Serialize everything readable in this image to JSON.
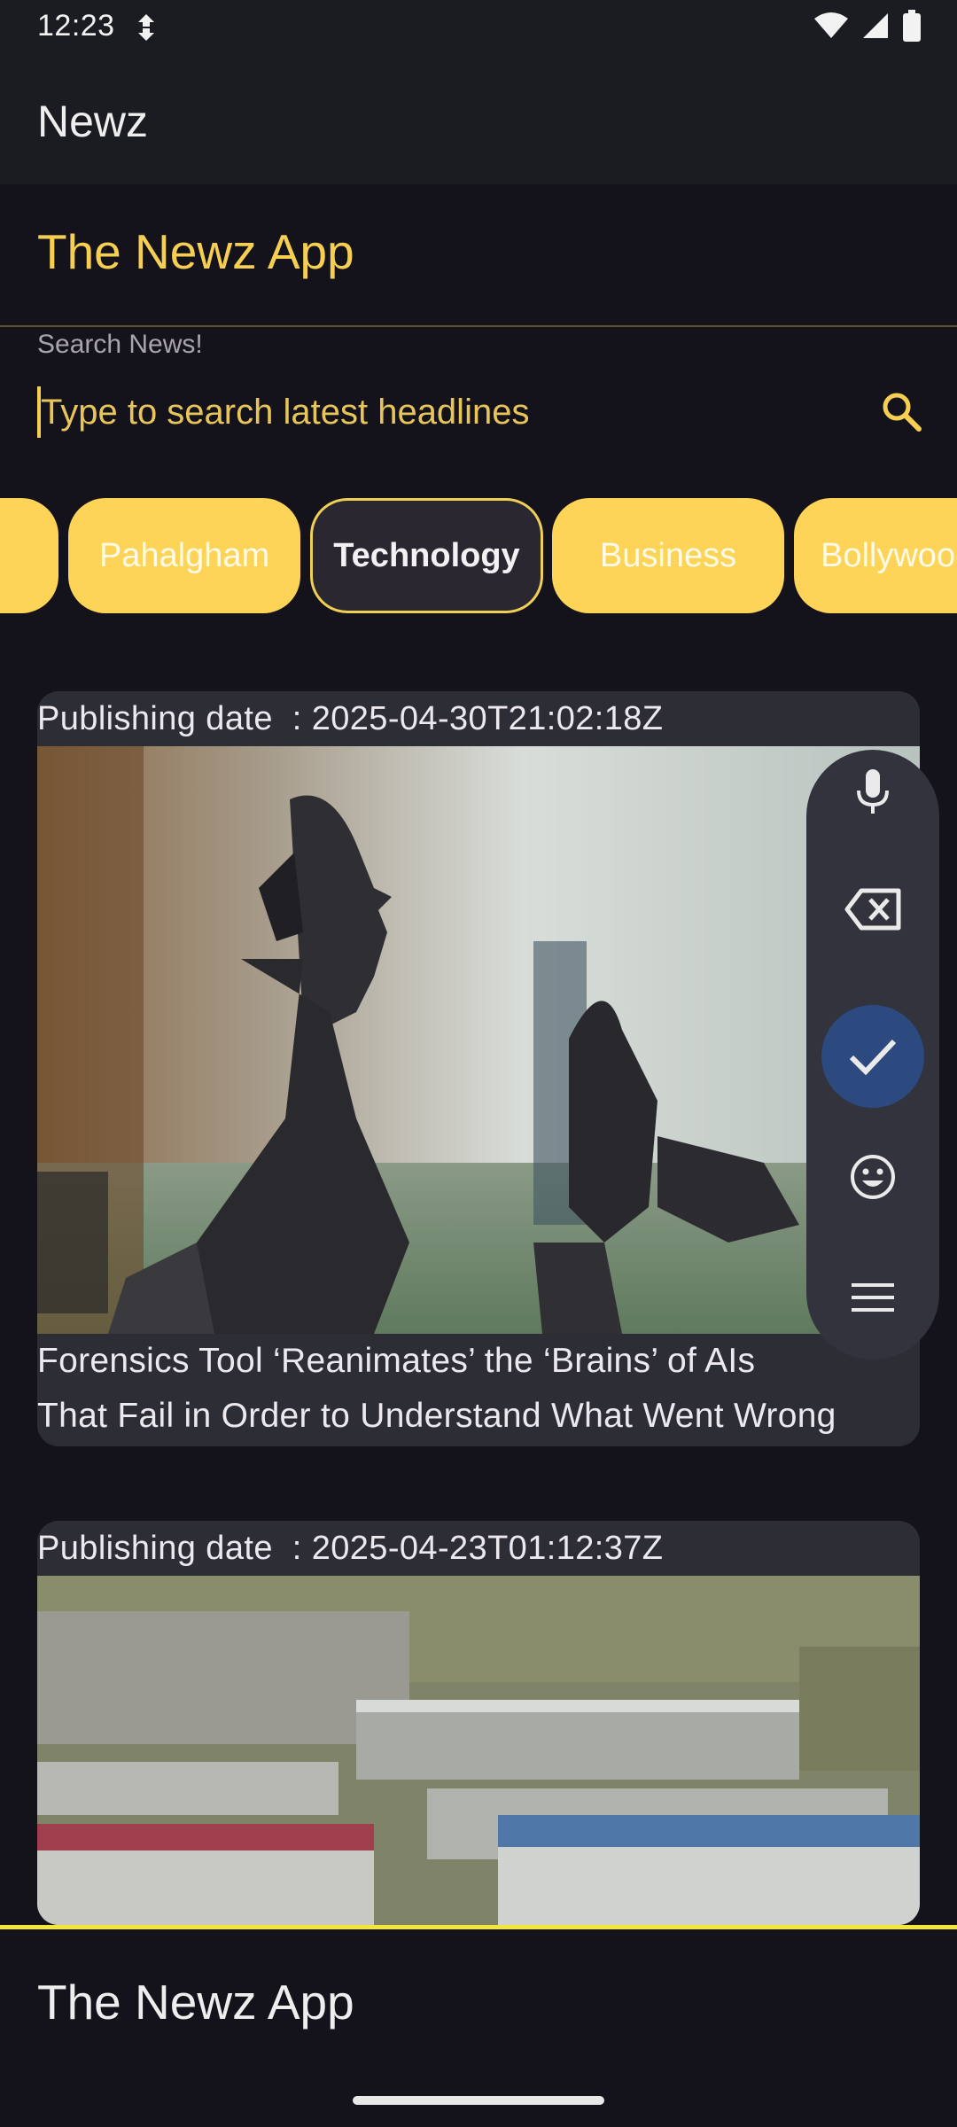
{
  "status_bar": {
    "time": "12:23"
  },
  "app_bar": {
    "title": "Newz"
  },
  "page": {
    "heading": "The Newz App"
  },
  "search": {
    "label": "Search News!",
    "placeholder": "Type to search latest headlines",
    "value": ""
  },
  "categories": {
    "items": [
      {
        "label": "",
        "selected": false
      },
      {
        "label": "Pahalgham",
        "selected": false
      },
      {
        "label": "Technology",
        "selected": true
      },
      {
        "label": "Business",
        "selected": false
      },
      {
        "label": "Bollywood",
        "selected": false
      }
    ]
  },
  "articles": [
    {
      "date_label": "Publishing date",
      "date_value": ": 2025-04-30T21:02:18Z",
      "title_lines": [
        "Forensics Tool ‘Reanimates’ the ‘Brains’ of AIs",
        "That Fail in Order to Understand What Went Wrong"
      ]
    },
    {
      "date_label": "Publishing date",
      "date_value": ": 2025-04-23T01:12:37Z"
    }
  ],
  "keyboard_toolbar": {
    "items": [
      "microphone-icon",
      "backspace-icon",
      "check-icon",
      "emoji-icon",
      "menu-icon"
    ]
  },
  "bottom_bar": {
    "title": "The Newz App"
  },
  "colors": {
    "accent": "#f6cf52",
    "background": "#14131b",
    "surface": "#1b1c22",
    "card": "#2d2d36",
    "fab_primary": "#2c4a80",
    "bottom_border": "#f3e53a"
  }
}
